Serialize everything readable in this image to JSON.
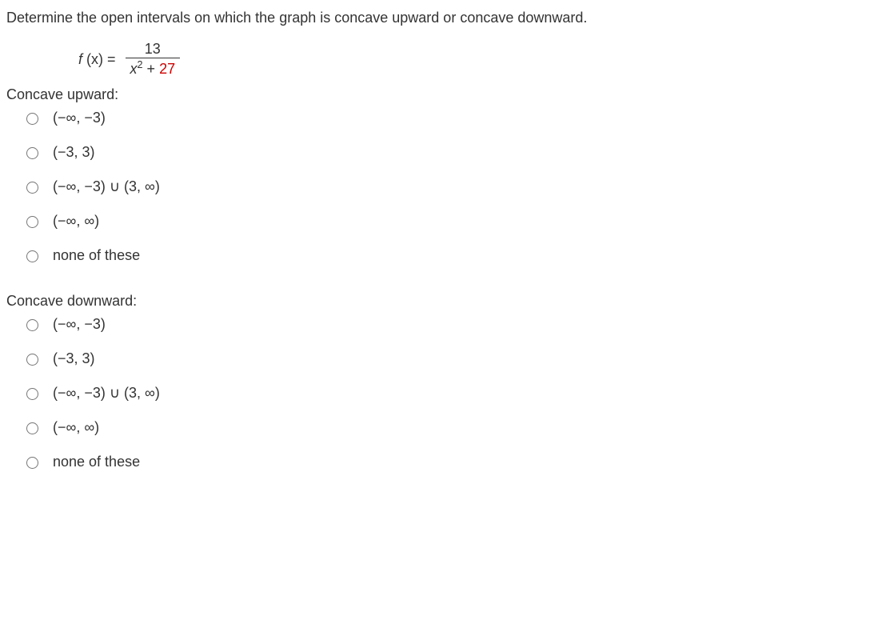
{
  "prompt": "Determine the open intervals on which the graph is concave upward or concave downward.",
  "function": {
    "label_f": "f",
    "label_x": " (x) = ",
    "numerator": "13",
    "den_x": "x",
    "den_exp": "2",
    "den_plus": " + ",
    "den_const": "27"
  },
  "section_up": "Concave upward:",
  "section_down": "Concave downward:",
  "choices": [
    "(−∞, −3)",
    "(−3, 3)",
    "(−∞, −3) ∪ (3, ∞)",
    "(−∞, ∞)",
    "none of these"
  ]
}
